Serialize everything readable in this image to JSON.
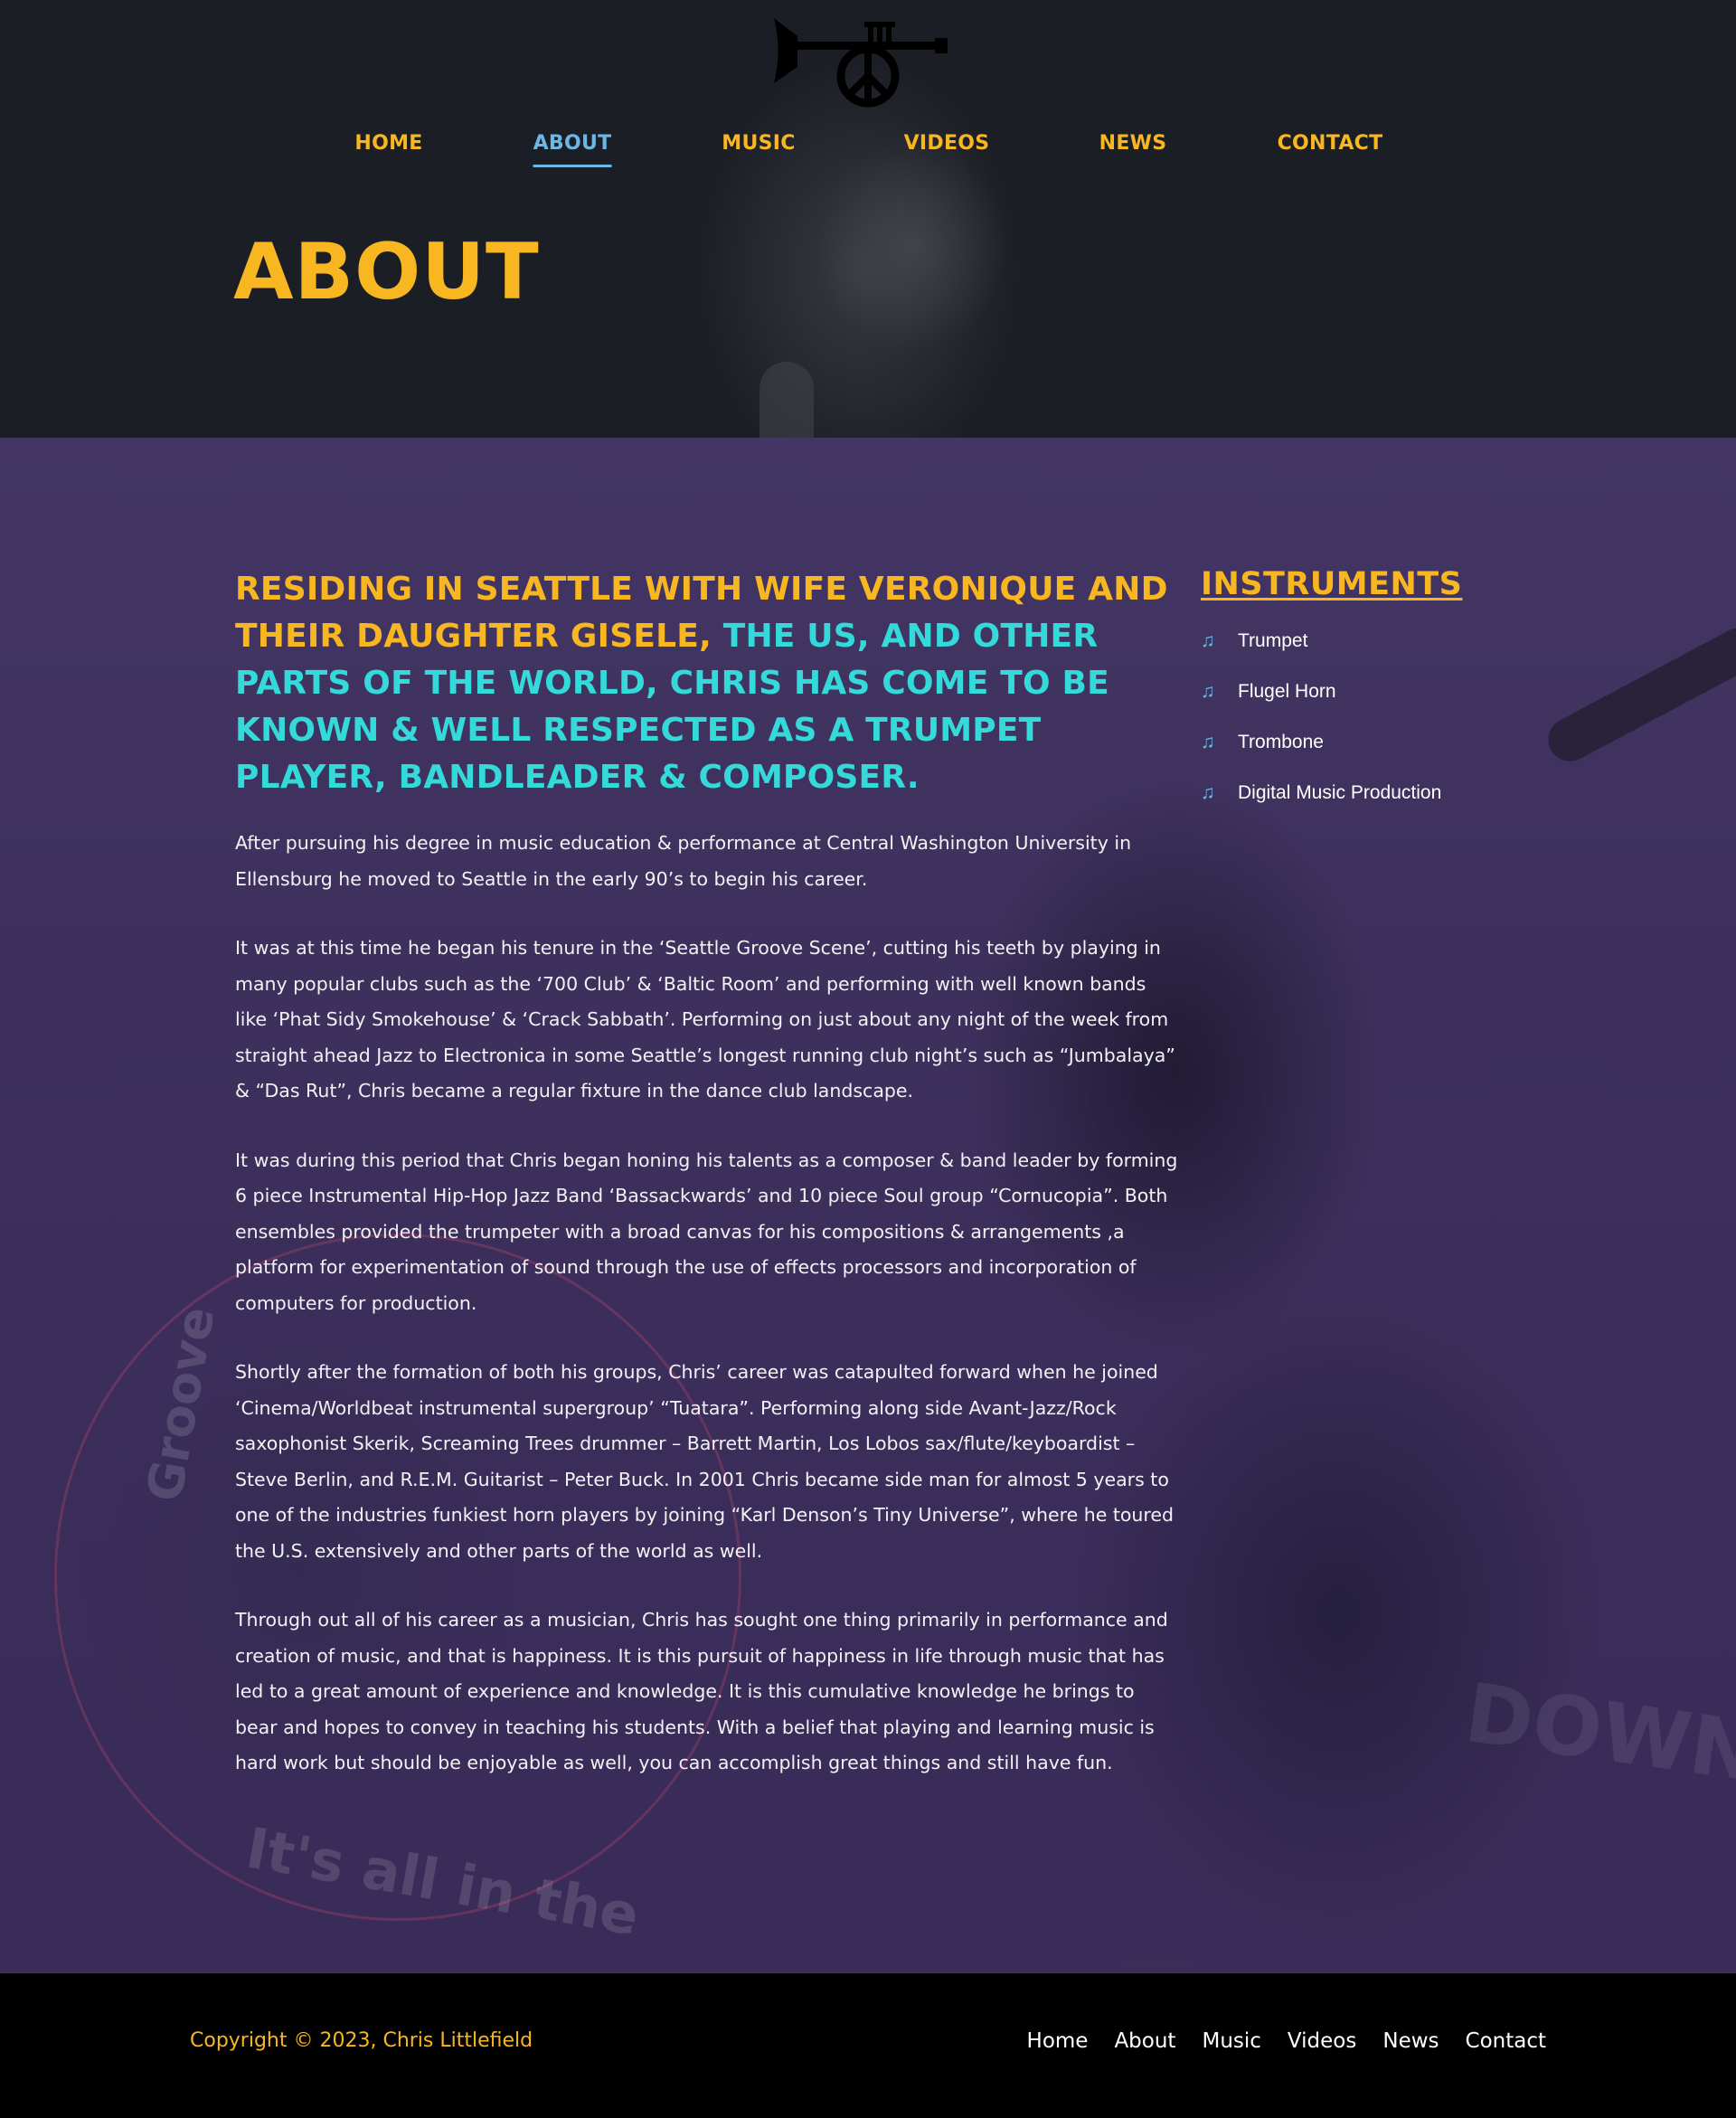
{
  "header": {
    "logo_name": "trumpet-peace-logo",
    "nav": [
      {
        "label": "HOME",
        "active": false
      },
      {
        "label": "ABOUT",
        "active": true
      },
      {
        "label": "MUSIC",
        "active": false
      },
      {
        "label": "VIDEOS",
        "active": false
      },
      {
        "label": "NEWS",
        "active": false
      },
      {
        "label": "CONTACT",
        "active": false
      }
    ],
    "page_title": "ABOUT"
  },
  "main": {
    "headline_part1": "RESIDING IN SEATTLE WITH WIFE VERONIQUE AND THEIR DAUGHTER GISELE, ",
    "headline_part2": "THE US, AND OTHER PARTS OF THE WORLD, CHRIS HAS COME TO BE KNOWN & WELL RESPECTED AS A TRUMPET PLAYER, BANDLEADER & COMPOSER.",
    "paragraphs": [
      "After pursuing his degree in music education & performance at Central Washington University in Ellensburg he moved to Seattle in the early 90’s to begin his career.",
      "It was at this time he began his tenure in the ‘Seattle Groove Scene’, cutting his teeth by playing in many popular clubs such as the ‘700 Club’ & ‘Baltic Room’ and performing with well known bands like ‘Phat Sidy Smokehouse’ & ‘Crack Sabbath’. Performing on just about any night of the week from straight ahead Jazz to Electronica in some Seattle’s longest running club night’s such as “Jumbalaya” & “Das Rut”, Chris became a regular fixture in the dance club landscape.",
      "It was during this period that Chris began honing his talents as a composer & band leader by forming 6 piece Instrumental Hip-Hop Jazz Band ‘Bassackwards’ and 10 piece Soul group “Cornucopia”. Both ensembles provided the trumpeter with a broad canvas for his compositions & arrangements ,a platform for experimentation of sound through the use of effects processors and incorporation of computers for production.",
      "Shortly after the formation of both his groups, Chris’ career was catapulted forward when he joined ‘Cinema/Worldbeat instrumental supergroup’ “Tuatara”. Performing along side Avant-Jazz/Rock saxophonist Skerik, Screaming Trees drummer – Barrett Martin, Los Lobos sax/flute/keyboardist – Steve Berlin, and R.E.M. Guitarist – Peter Buck. In 2001 Chris became side man for almost 5 years to one of the industries funkiest horn players by joining “Karl Denson’s Tiny Universe”, where he toured the U.S. extensively and other parts of the world as well.",
      "Through out all of his career as a musician, Chris has sought one thing primarily in performance and creation of music, and that is happiness. It is this pursuit of happiness in life through music that has led to a great amount of experience and knowledge. It is this cumulative knowledge he brings to bear and hopes to convey in teaching his students. With a belief that playing and learning music is hard work but should be enjoyable as well, you can accomplish great things and still have fun."
    ]
  },
  "sidebar": {
    "title": "INSTRUMENTS",
    "icon": "music-note-icon",
    "items": [
      "Trumpet",
      "Flugel Horn",
      "Trombone",
      "Digital Music Production"
    ]
  },
  "footer": {
    "copyright": "Copyright © 2023, Chris Littlefield",
    "links": [
      "Home",
      "About",
      "Music",
      "Videos",
      "News",
      "Contact"
    ]
  },
  "colors": {
    "accent_yellow": "#f8b620",
    "accent_cyan": "#34d9d9",
    "active_blue": "#6bb7e6",
    "header_bg": "#1b1e25",
    "main_bg": "#3d305c",
    "footer_bg": "#000000"
  }
}
